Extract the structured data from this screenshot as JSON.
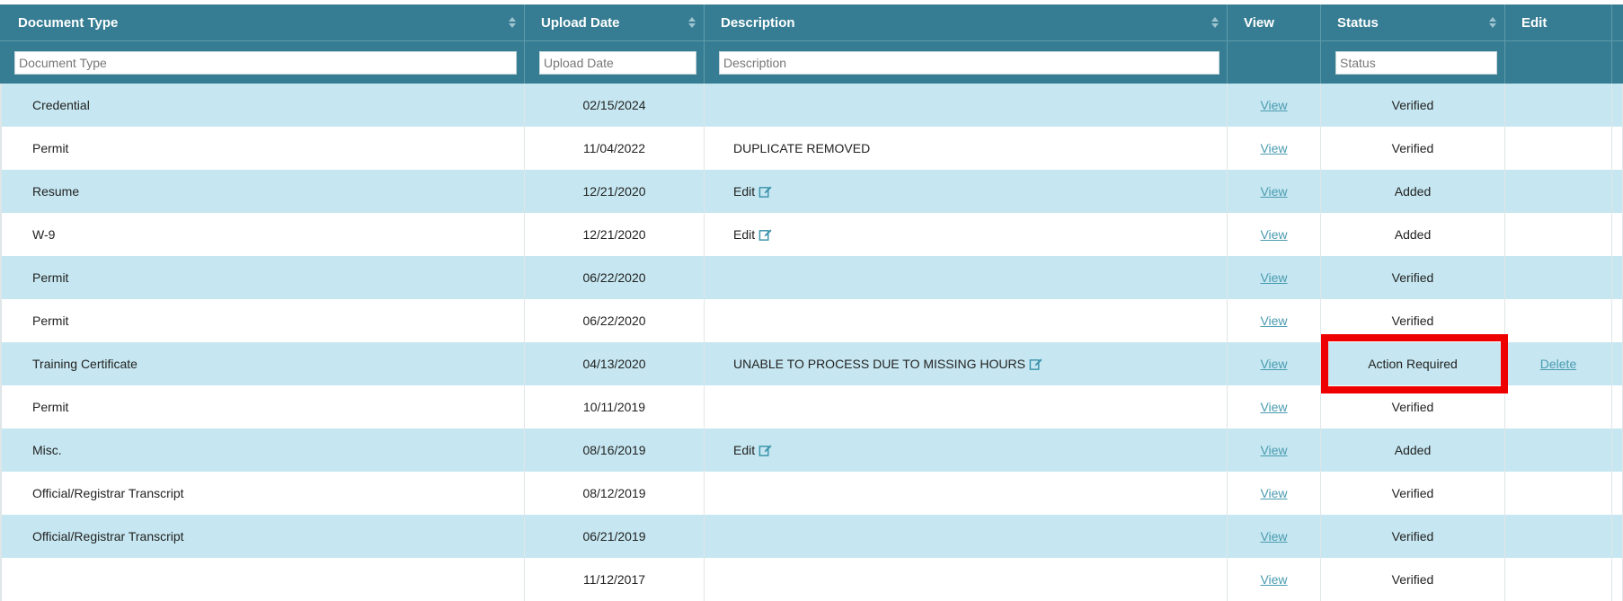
{
  "columns": [
    {
      "label": "Document Type",
      "filter_placeholder": "Document Type",
      "sortable": true
    },
    {
      "label": "Upload Date",
      "filter_placeholder": "Upload Date",
      "sortable": true
    },
    {
      "label": "Description",
      "filter_placeholder": "Description",
      "sortable": true
    },
    {
      "label": "View",
      "sortable": false
    },
    {
      "label": "Status",
      "filter_placeholder": "Status",
      "sortable": true
    },
    {
      "label": "Edit",
      "sortable": false
    }
  ],
  "rows": [
    {
      "type": "Credential",
      "date": "02/15/2024",
      "description": "",
      "desc_edit_icon": false,
      "view": "View",
      "status": "Verified",
      "edit": ""
    },
    {
      "type": "Permit",
      "date": "11/04/2022",
      "description": "DUPLICATE REMOVED",
      "desc_edit_icon": false,
      "view": "View",
      "status": "Verified",
      "edit": ""
    },
    {
      "type": "Resume",
      "date": "12/21/2020",
      "description": "Edit",
      "desc_edit_icon": true,
      "view": "View",
      "status": "Added",
      "edit": ""
    },
    {
      "type": "W-9",
      "date": "12/21/2020",
      "description": "Edit",
      "desc_edit_icon": true,
      "view": "View",
      "status": "Added",
      "edit": ""
    },
    {
      "type": "Permit",
      "date": "06/22/2020",
      "description": "",
      "desc_edit_icon": false,
      "view": "View",
      "status": "Verified",
      "edit": ""
    },
    {
      "type": "Permit",
      "date": "06/22/2020",
      "description": "",
      "desc_edit_icon": false,
      "view": "View",
      "status": "Verified",
      "edit": ""
    },
    {
      "type": "Training Certificate",
      "date": "04/13/2020",
      "description": "UNABLE TO PROCESS DUE TO MISSING HOURS",
      "desc_edit_icon": true,
      "view": "View",
      "status": "Action Required",
      "edit": "Delete"
    },
    {
      "type": "Permit",
      "date": "10/11/2019",
      "description": "",
      "desc_edit_icon": false,
      "view": "View",
      "status": "Verified",
      "edit": ""
    },
    {
      "type": "Misc.",
      "date": "08/16/2019",
      "description": "Edit",
      "desc_edit_icon": true,
      "view": "View",
      "status": "Added",
      "edit": ""
    },
    {
      "type": "Official/Registrar Transcript",
      "date": "08/12/2019",
      "description": "",
      "desc_edit_icon": false,
      "view": "View",
      "status": "Verified",
      "edit": ""
    },
    {
      "type": "Official/Registrar Transcript",
      "date": "06/21/2019",
      "description": "",
      "desc_edit_icon": false,
      "view": "View",
      "status": "Verified",
      "edit": ""
    },
    {
      "type": "",
      "date": "11/12/2017",
      "description": "",
      "desc_edit_icon": false,
      "view": "View",
      "status": "Verified",
      "edit": ""
    }
  ],
  "colors": {
    "header_bg": "#367d93",
    "row_alt_bg": "#c6e7f1",
    "link": "#4a9bb0",
    "highlight_border": "#ee0000"
  },
  "icons": {
    "sort": "sort-arrows-icon",
    "edit": "edit-pencil-square-icon"
  }
}
